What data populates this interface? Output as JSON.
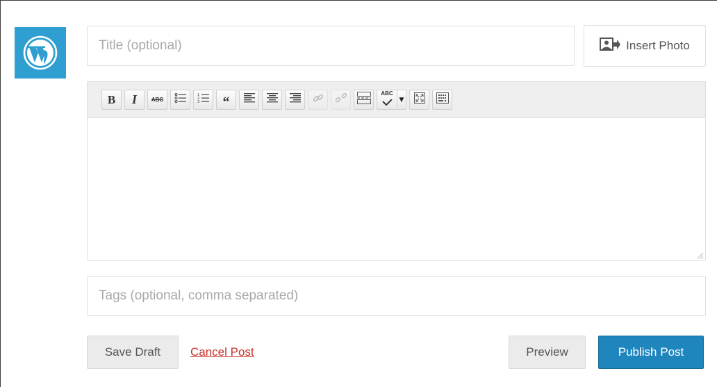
{
  "logo": {
    "icon": "wordpress-logo",
    "bg_color": "#2e9fd0"
  },
  "title_field": {
    "placeholder": "Title (optional)",
    "value": ""
  },
  "insert_photo": {
    "label": "Insert Photo",
    "icon": "insert-photo-icon"
  },
  "toolbar": {
    "bold": {
      "label": "B",
      "icon": "bold-icon"
    },
    "italic": {
      "label": "I",
      "icon": "italic-icon"
    },
    "strikethrough": {
      "label": "ABC",
      "icon": "strikethrough-icon"
    },
    "bullet_list": {
      "icon": "bullet-list-icon"
    },
    "numbered_list": {
      "icon": "numbered-list-icon"
    },
    "blockquote": {
      "label": "66",
      "icon": "blockquote-icon"
    },
    "align_left": {
      "icon": "align-left-icon"
    },
    "align_center": {
      "icon": "align-center-icon"
    },
    "align_right": {
      "icon": "align-right-icon"
    },
    "insert_link": {
      "icon": "link-icon",
      "disabled": true
    },
    "remove_link": {
      "icon": "unlink-icon",
      "disabled": true
    },
    "insert_more": {
      "icon": "more-tag-icon"
    },
    "spellcheck": {
      "label": "ABC",
      "icon": "spellcheck-icon"
    },
    "fullscreen": {
      "icon": "fullscreen-icon"
    },
    "kitchen_sink": {
      "icon": "kitchen-sink-icon"
    }
  },
  "editor_content": {
    "value": ""
  },
  "tags_field": {
    "placeholder": "Tags (optional, comma separated)",
    "value": ""
  },
  "actions": {
    "save_draft": "Save Draft",
    "cancel_post": "Cancel Post",
    "preview": "Preview",
    "publish_post": "Publish Post"
  },
  "colors": {
    "accent": "#1f85bd",
    "cancel_link": "#c7322b",
    "logo_bg": "#2e9fd0"
  }
}
